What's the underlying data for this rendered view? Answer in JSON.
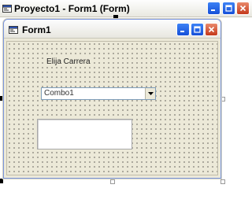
{
  "project_window": {
    "title": "Proyecto1 - Form1 (Form)",
    "icon": "vb-form-icon",
    "caption_buttons": [
      "minimize-icon",
      "maximize-icon",
      "close-icon"
    ]
  },
  "form_window": {
    "title": "Form1",
    "icon": "vb-form-icon",
    "caption_buttons": [
      "minimize-icon",
      "maximize-icon",
      "close-icon"
    ]
  },
  "form_controls": {
    "label_text": "Elija Carrera",
    "combo_text": "Combo1",
    "combo_arrow_icon": "chevron-down-icon",
    "listbox_items": []
  },
  "colors": {
    "form_background": "#ece9d8",
    "title_bar_button_blue": "#2f6ee8",
    "close_button_red": "#d4502f"
  }
}
